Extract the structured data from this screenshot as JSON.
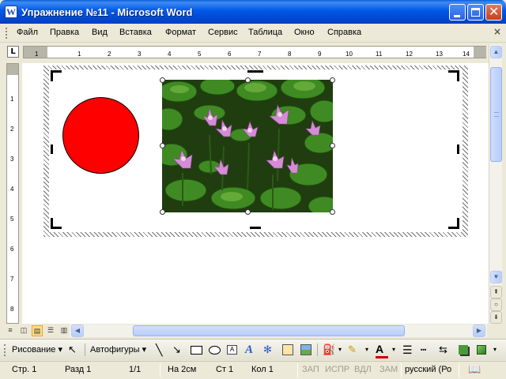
{
  "window": {
    "title": "Упражнение №11 - Microsoft Word",
    "app_icon_letter": "W",
    "minimize_icon": "minimize-icon",
    "maximize_icon": "maximize-icon",
    "close_icon": "close-icon"
  },
  "menu": {
    "items": [
      "Файл",
      "Правка",
      "Вид",
      "Вставка",
      "Формат",
      "Сервис",
      "Таблица",
      "Окно",
      "Справка"
    ],
    "close_doc": "×"
  },
  "ruler": {
    "tab_stop": "L",
    "h_ticks": [
      "1",
      "1",
      "2",
      "3",
      "4",
      "5",
      "6",
      "7",
      "8",
      "9",
      "10",
      "11",
      "12",
      "13",
      "14"
    ],
    "v_ticks": [
      "1",
      "2",
      "3",
      "4",
      "5",
      "6",
      "7",
      "8"
    ]
  },
  "document": {
    "shapes": [
      {
        "kind": "circle",
        "fill": "#ff0000",
        "stroke": "#000000"
      },
      {
        "kind": "picture",
        "subject": "water-lilies",
        "selected": true
      }
    ]
  },
  "views": [
    "normal-view-icon",
    "web-view-icon",
    "print-layout-view-icon",
    "outline-view-icon",
    "reading-view-icon"
  ],
  "drawing_toolbar": {
    "draw_label": "Рисование",
    "autoshapes_label": "Автофигуры",
    "font_color_letter": "A"
  },
  "status": {
    "page": "Стр. 1",
    "section": "Разд 1",
    "pages": "1/1",
    "at": "На 2см",
    "line": "Ст 1",
    "col": "Кол 1",
    "rec": "ЗАП",
    "trk": "ИСПР",
    "ext": "ВДЛ",
    "ovr": "ЗАМ",
    "language": "русский (Ро"
  },
  "colors": {
    "titlebar": "#0054e3",
    "circle": "#ff0000",
    "selected_view": "#fde08a"
  }
}
